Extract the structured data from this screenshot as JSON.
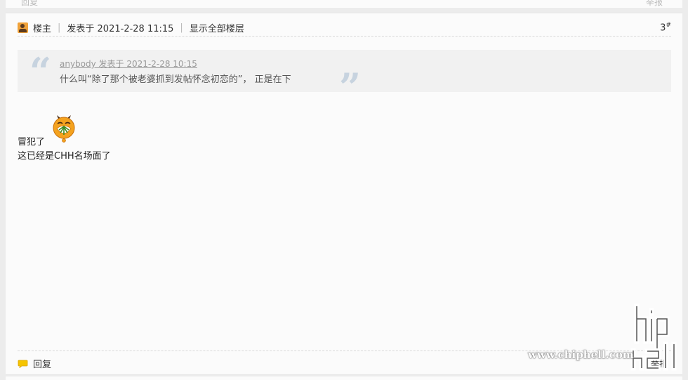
{
  "prev_post": {
    "reply_label": "回复",
    "report_label": "举报"
  },
  "post": {
    "op_label": "楼主",
    "posted_at": "发表于 2021-2-28 11:15",
    "show_all_label": "显示全部楼层",
    "floor_number": "3",
    "floor_suffix": "#",
    "quote": {
      "author_line": "anybody 发表于 2021-2-28 10:15",
      "text": "什么叫“除了那个被老婆抓到发帖怀念初恋的”， 正是在下"
    },
    "body_lines": [
      "冒犯了",
      "这已经是CHH名场面了"
    ],
    "smiley_icon": "embarrassed-smiley-icon",
    "reply_label": "回复",
    "report_label": "举报"
  },
  "watermark": {
    "logo_text": "chip hell",
    "url_text": "www.chiphell.com"
  },
  "colors": {
    "accent_orange": "#f0a23a",
    "reply_yellow": "#f5c400",
    "quote_mark": "#c7d3df"
  }
}
